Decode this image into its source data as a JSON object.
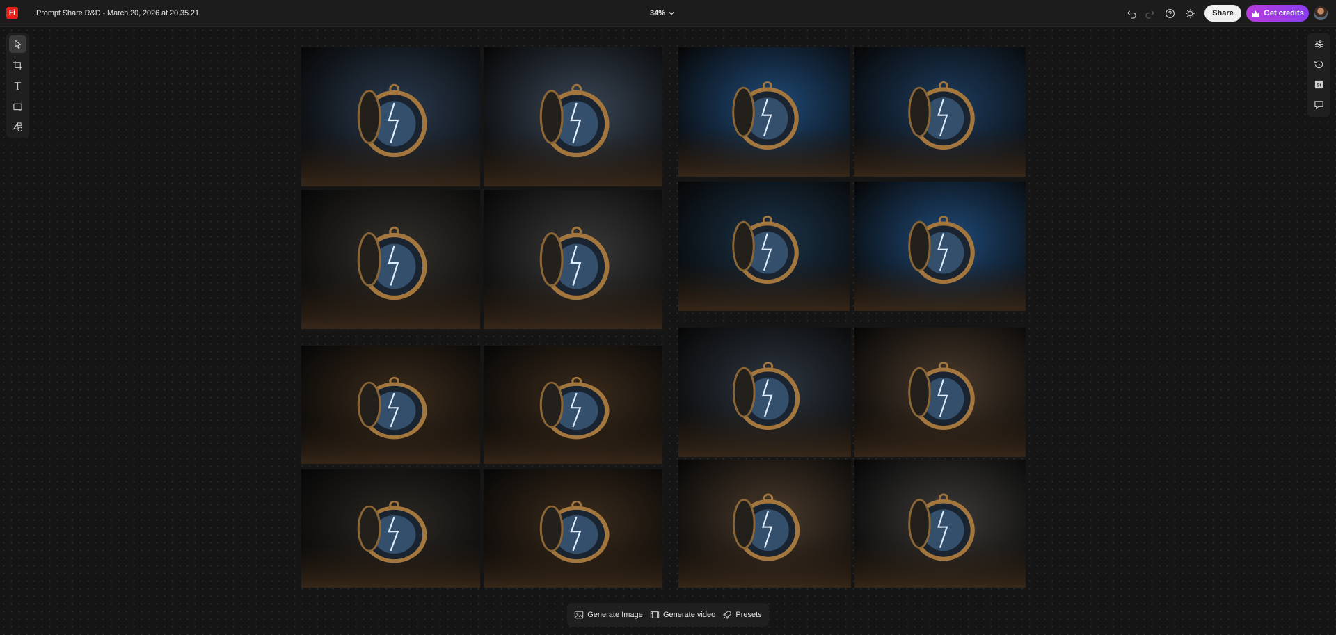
{
  "app": {
    "logo_text": "Fi",
    "document_title": "Prompt Share R&D - March 20, 2026 at 20.35.21"
  },
  "toolbar": {
    "zoom_level": "34%",
    "share_label": "Share",
    "credits_label": "Get credits"
  },
  "left_tools": [
    "select-tool",
    "artboard-tool",
    "text-tool",
    "shape-tool",
    "generate-fill-tool"
  ],
  "right_tools": [
    "properties-panel",
    "history-panel",
    "stock-panel",
    "comments-panel"
  ],
  "right_rail": {
    "stock_label": "St"
  },
  "bottom_bar": {
    "generate_image_label": "Generate Image",
    "generate_video_label": "Generate video",
    "presets_label": "Presets"
  },
  "colors": {
    "brand_red": "#e62017",
    "credits_gradient_start": "#b43cdc",
    "credits_gradient_end": "#8a3cf0",
    "canvas": "#151515"
  },
  "images": [
    {
      "name": "pocket-watch-cloud-1",
      "tone": "#2a3a4e"
    },
    {
      "name": "pocket-watch-lightning-2",
      "tone": "#3a4656"
    },
    {
      "name": "pocket-watch-cloud-3",
      "tone": "#33302c"
    },
    {
      "name": "pocket-watch-cloud-4",
      "tone": "#3a3a3a"
    },
    {
      "name": "pocket-watch-storm-5",
      "tone": "#1f4a78"
    },
    {
      "name": "pocket-watch-storm-6",
      "tone": "#1d3c5e"
    },
    {
      "name": "pocket-watch-storm-7",
      "tone": "#1b3348"
    },
    {
      "name": "pocket-watch-clockface-8",
      "tone": "#1f4a78"
    },
    {
      "name": "pocket-watch-open-9",
      "tone": "#3c2c1c"
    },
    {
      "name": "pocket-watch-open-10",
      "tone": "#3c2c1c"
    },
    {
      "name": "pocket-watch-open-11",
      "tone": "#2c2824"
    },
    {
      "name": "pocket-watch-open-12",
      "tone": "#3c2c1c"
    },
    {
      "name": "pocket-watch-books-13",
      "tone": "#2e3640"
    },
    {
      "name": "pocket-watch-books-14",
      "tone": "#4a3a2c"
    },
    {
      "name": "pocket-watch-books-15",
      "tone": "#4a3a2c"
    },
    {
      "name": "pocket-watch-books-16",
      "tone": "#3c3a38"
    }
  ]
}
